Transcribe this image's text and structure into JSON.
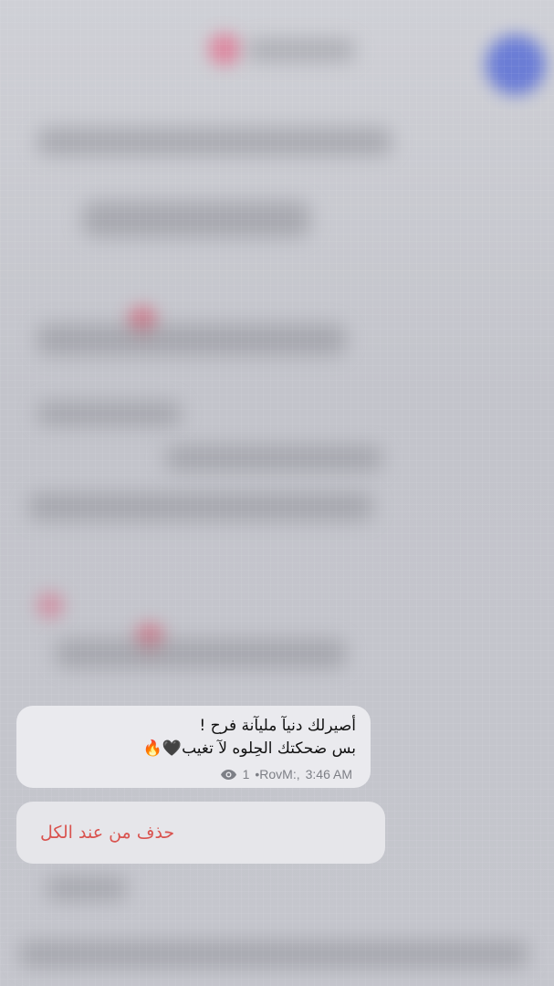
{
  "message": {
    "lines": [
      "أصيرلك دنيآ مليآنة فرح !",
      "بس ضحكتك الحِلوه لآ تغيب🖤🔥"
    ],
    "views": "1",
    "author_signature": "•RovM:,",
    "time": "3:46 AM"
  },
  "context_menu": {
    "delete_for_all_label": "حذف من عند الكل"
  },
  "colors": {
    "bubble": "#eaeaee",
    "action_bg": "#e6e6ea",
    "danger": "#d9534f",
    "meta": "#7d7f86",
    "avatar_accent": "#4f6bd6"
  },
  "icons": {
    "views": "eye-icon"
  }
}
